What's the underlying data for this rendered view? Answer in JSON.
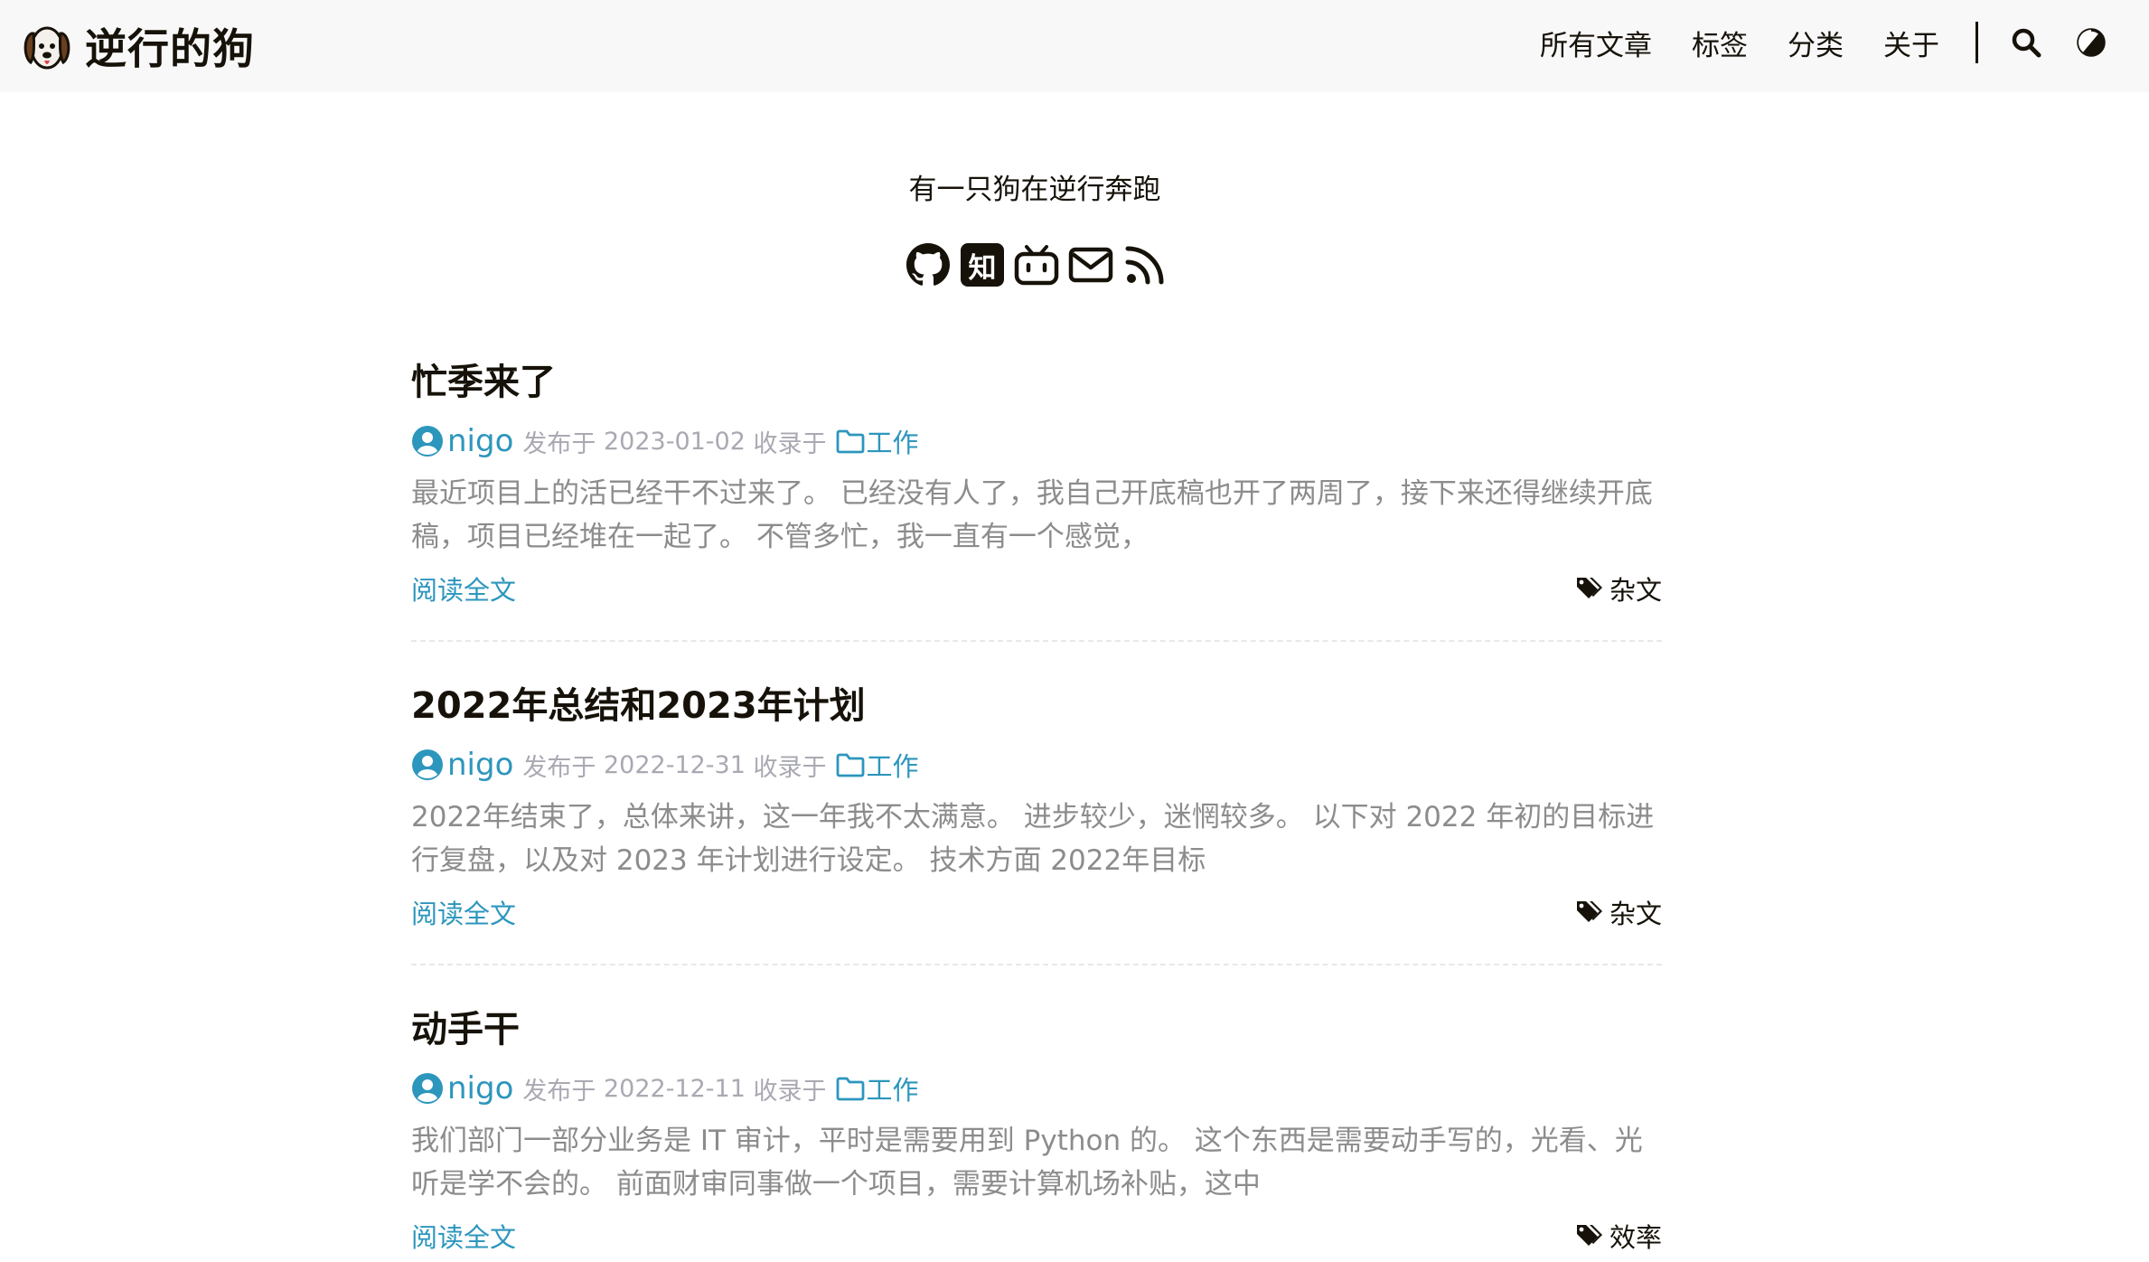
{
  "header": {
    "site_title": "逆行的狗",
    "menu": [
      {
        "label": "所有文章"
      },
      {
        "label": "标签"
      },
      {
        "label": "分类"
      },
      {
        "label": "关于"
      }
    ],
    "icons": [
      "search-icon",
      "theme-toggle-icon"
    ]
  },
  "profile": {
    "subtitle": "有一只狗在逆行奔跑",
    "social": [
      {
        "name": "github-icon"
      },
      {
        "name": "zhihu-icon",
        "glyph": "知"
      },
      {
        "name": "bilibili-icon"
      },
      {
        "name": "email-icon"
      },
      {
        "name": "rss-icon"
      }
    ]
  },
  "posts": [
    {
      "title": "忙季来了",
      "author": "nigo",
      "published_label": "发布于",
      "date": "2023-01-02",
      "collected_label": "收录于",
      "category": "工作",
      "summary": "最近项目上的活已经干不过来了。 已经没有人了，我自己开底稿也开了两周了，接下来还得继续开底稿，项目已经堆在一起了。 不管多忙，我一直有一个感觉，",
      "read_more": "阅读全文",
      "tag": "杂文"
    },
    {
      "title": "2022年总结和2023年计划",
      "author": "nigo",
      "published_label": "发布于",
      "date": "2022-12-31",
      "collected_label": "收录于",
      "category": "工作",
      "summary": "2022年结束了，总体来讲，这一年我不太满意。 进步较少，迷惘较多。 以下对 2022 年初的目标进行复盘，以及对 2023 年计划进行设定。 技术方面 2022年目标",
      "read_more": "阅读全文",
      "tag": "杂文"
    },
    {
      "title": "动手干",
      "author": "nigo",
      "published_label": "发布于",
      "date": "2022-12-11",
      "collected_label": "收录于",
      "category": "工作",
      "summary": "我们部门一部分业务是 IT 审计，平时是需要用到 Python 的。 这个东西是需要动手写的，光看、光听是学不会的。 前面财审同事做一个项目，需要计算机场补贴，这中",
      "read_more": "阅读全文",
      "tag": "效率"
    }
  ],
  "colors": {
    "link": "#2d96bd",
    "text": "#161209",
    "muted": "#a9a9b3",
    "summary": "#8c8c8c",
    "header_bg": "#f8f8f8"
  }
}
